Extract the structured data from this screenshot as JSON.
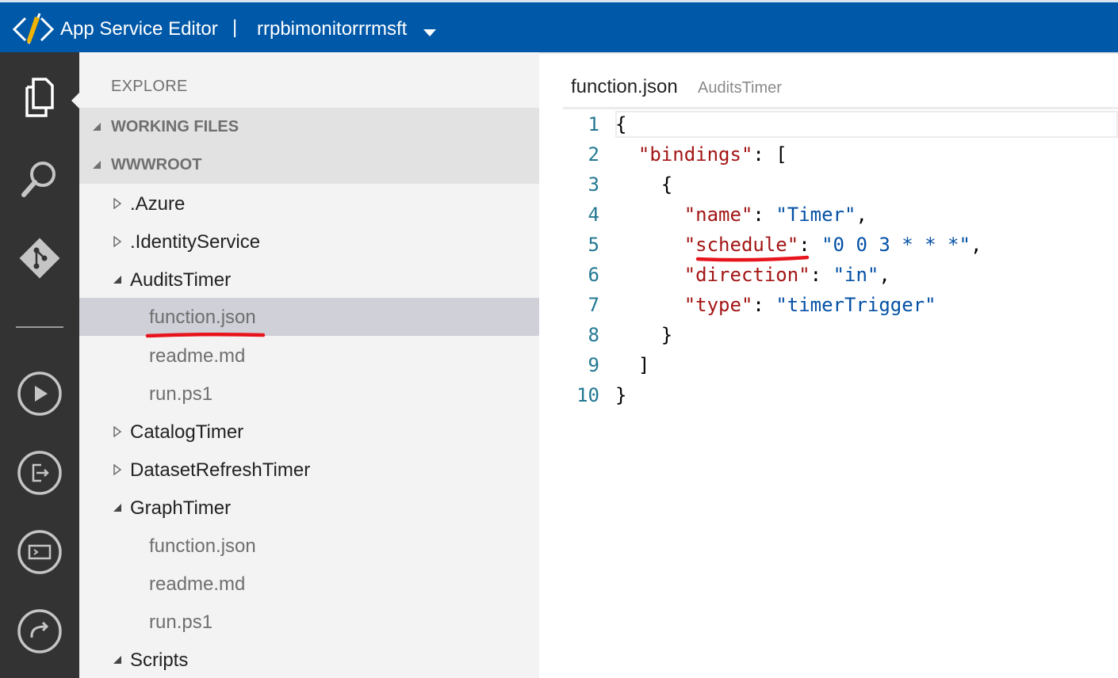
{
  "titlebar": {
    "app_title": "App Service Editor",
    "separator": "|",
    "site_name": "rrpbimonitorrrmsft",
    "bg_color": "#0058a8"
  },
  "activitybar": {
    "items": [
      {
        "name": "explorer",
        "icon": "files-icon",
        "active": true
      },
      {
        "name": "search",
        "icon": "search-icon"
      },
      {
        "name": "git",
        "icon": "git-icon"
      },
      {
        "name": "run",
        "icon": "run-icon"
      },
      {
        "name": "output",
        "icon": "output-icon"
      },
      {
        "name": "console",
        "icon": "console-icon"
      },
      {
        "name": "open-kudu",
        "icon": "open-kudu-icon"
      }
    ]
  },
  "sidebar": {
    "title": "EXPLORE",
    "sections": [
      {
        "label": "WORKING FILES"
      },
      {
        "label": "WWWROOT"
      }
    ],
    "tree": [
      {
        "label": ".Azure",
        "type": "folder",
        "expanded": false
      },
      {
        "label": ".IdentityService",
        "type": "folder",
        "expanded": false
      },
      {
        "label": "AuditsTimer",
        "type": "folder",
        "expanded": true
      },
      {
        "label": "function.json",
        "type": "file",
        "selected": true
      },
      {
        "label": "readme.md",
        "type": "file"
      },
      {
        "label": "run.ps1",
        "type": "file"
      },
      {
        "label": "CatalogTimer",
        "type": "folder",
        "expanded": false
      },
      {
        "label": "DatasetRefreshTimer",
        "type": "folder",
        "expanded": false
      },
      {
        "label": "GraphTimer",
        "type": "folder",
        "expanded": true
      },
      {
        "label": "function.json",
        "type": "file"
      },
      {
        "label": "readme.md",
        "type": "file"
      },
      {
        "label": "run.ps1",
        "type": "file"
      },
      {
        "label": "Scripts",
        "type": "folder",
        "expanded": true
      }
    ]
  },
  "editor": {
    "filename": "function.json",
    "context": "AuditsTimer",
    "line_numbers": [
      "1",
      "2",
      "3",
      "4",
      "5",
      "6",
      "7",
      "8",
      "9",
      "10"
    ],
    "lines": [
      {
        "indent": "",
        "parts": [
          {
            "t": "p",
            "v": "{"
          }
        ]
      },
      {
        "indent": "  ",
        "parts": [
          {
            "t": "k",
            "v": "\"bindings\""
          },
          {
            "t": "p",
            "v": ": ["
          }
        ]
      },
      {
        "indent": "    ",
        "parts": [
          {
            "t": "p",
            "v": "{"
          }
        ]
      },
      {
        "indent": "      ",
        "parts": [
          {
            "t": "k",
            "v": "\"name\""
          },
          {
            "t": "p",
            "v": ": "
          },
          {
            "t": "s",
            "v": "\"Timer\""
          },
          {
            "t": "p",
            "v": ","
          }
        ]
      },
      {
        "indent": "      ",
        "parts": [
          {
            "t": "k",
            "v": "\"schedule\""
          },
          {
            "t": "p",
            "v": ": "
          },
          {
            "t": "s",
            "v": "\"0 0 3 * * *\""
          },
          {
            "t": "p",
            "v": ","
          }
        ]
      },
      {
        "indent": "      ",
        "parts": [
          {
            "t": "k",
            "v": "\"direction\""
          },
          {
            "t": "p",
            "v": ": "
          },
          {
            "t": "s",
            "v": "\"in\""
          },
          {
            "t": "p",
            "v": ","
          }
        ]
      },
      {
        "indent": "      ",
        "parts": [
          {
            "t": "k",
            "v": "\"type\""
          },
          {
            "t": "p",
            "v": ": "
          },
          {
            "t": "s",
            "v": "\"timerTrigger\""
          }
        ]
      },
      {
        "indent": "    ",
        "parts": [
          {
            "t": "p",
            "v": "}"
          }
        ]
      },
      {
        "indent": "  ",
        "parts": [
          {
            "t": "p",
            "v": "]"
          }
        ]
      },
      {
        "indent": "",
        "parts": [
          {
            "t": "p",
            "v": "}"
          }
        ]
      }
    ]
  },
  "colors": {
    "sidebar_bg": "#f3f3f3",
    "activitybar_bg": "#333333",
    "selected_row": "#cfd0d8",
    "json_key": "#a31515",
    "json_string": "#0451a5",
    "line_number": "#237893",
    "annotation": "#e8141c"
  }
}
